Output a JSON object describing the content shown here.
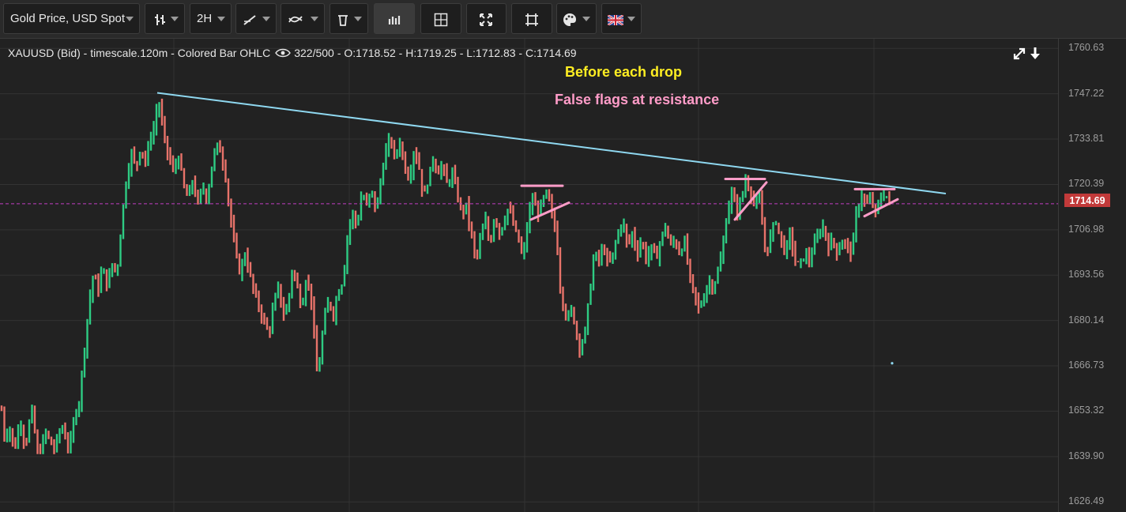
{
  "toolbar": {
    "symbol_select": "Gold Price, USD Spot",
    "timeframe": "2H",
    "icons": [
      "chart-style-icon",
      "timeframe-icon",
      "drawing-line-icon",
      "indicators-icon",
      "delete-drawing-icon",
      "volume-bars-icon",
      "crosshair-icon",
      "fullscreen-icon",
      "fit-screen-icon",
      "palette-icon",
      "language-flag-icon"
    ]
  },
  "header": {
    "instrument": "XAUUSD (Bid) - timescale.120m - Colored Bar OHLC",
    "bar_count": "322/500",
    "ohlc": "- O:1718.52 - H:1719.25 - L:1712.83 - C:1714.69"
  },
  "annotations": {
    "line1": "Before each drop",
    "line2": "False flags at resistance"
  },
  "colors": {
    "up": "#2ecc83",
    "down": "#e8736a",
    "trendline": "#8fd8f0",
    "flag": "#ff9cc8",
    "current_price_line": "#c13cc4",
    "price_tag": "#c23a3a",
    "annotation_yellow": "#ffee22",
    "grid": "#333333"
  },
  "chart_data": {
    "type": "ohlc",
    "symbol": "XAUUSD",
    "yaxis": {
      "ylim": [
        1623.5,
        1763.5
      ],
      "ticks": [
        "1760.63",
        "1747.22",
        "1733.81",
        "1720.39",
        "1714.69",
        "1706.98",
        "1693.56",
        "1680.14",
        "1666.73",
        "1653.32",
        "1639.90",
        "1626.49"
      ],
      "tick_values": [
        1760.63,
        1747.22,
        1733.81,
        1720.39,
        1706.98,
        1693.56,
        1680.14,
        1666.73,
        1653.32,
        1639.9,
        1626.49
      ]
    },
    "current_price": 1714.69,
    "grid": true,
    "path": [
      [
        0,
        1658
      ],
      [
        6,
        1645
      ],
      [
        12,
        1649
      ],
      [
        18,
        1641
      ],
      [
        25,
        1651
      ],
      [
        32,
        1643
      ],
      [
        40,
        1654
      ],
      [
        48,
        1640
      ],
      [
        58,
        1647
      ],
      [
        68,
        1642
      ],
      [
        78,
        1649
      ],
      [
        88,
        1642
      ],
      [
        96,
        1654
      ],
      [
        100,
        1656
      ],
      [
        106,
        1670
      ],
      [
        112,
        1684
      ],
      [
        118,
        1694
      ],
      [
        124,
        1689
      ],
      [
        130,
        1696
      ],
      [
        136,
        1690
      ],
      [
        142,
        1697
      ],
      [
        148,
        1694
      ],
      [
        154,
        1710
      ],
      [
        160,
        1722
      ],
      [
        166,
        1730
      ],
      [
        172,
        1725
      ],
      [
        178,
        1732
      ],
      [
        184,
        1727
      ],
      [
        190,
        1734
      ],
      [
        196,
        1738
      ],
      [
        200,
        1746
      ],
      [
        204,
        1740
      ],
      [
        208,
        1734
      ],
      [
        214,
        1728
      ],
      [
        220,
        1724
      ],
      [
        226,
        1729
      ],
      [
        232,
        1720
      ],
      [
        238,
        1716
      ],
      [
        244,
        1722
      ],
      [
        250,
        1714
      ],
      [
        256,
        1720
      ],
      [
        262,
        1716
      ],
      [
        268,
        1726
      ],
      [
        274,
        1732
      ],
      [
        280,
        1730
      ],
      [
        286,
        1722
      ],
      [
        292,
        1710
      ],
      [
        298,
        1700
      ],
      [
        304,
        1694
      ],
      [
        310,
        1700
      ],
      [
        316,
        1694
      ],
      [
        322,
        1688
      ],
      [
        328,
        1684
      ],
      [
        334,
        1680
      ],
      [
        340,
        1676
      ],
      [
        346,
        1684
      ],
      [
        352,
        1690
      ],
      [
        358,
        1682
      ],
      [
        364,
        1684
      ],
      [
        370,
        1696
      ],
      [
        376,
        1690
      ],
      [
        382,
        1684
      ],
      [
        388,
        1694
      ],
      [
        394,
        1686
      ],
      [
        398,
        1674
      ],
      [
        402,
        1662
      ],
      [
        406,
        1672
      ],
      [
        410,
        1680
      ],
      [
        416,
        1686
      ],
      [
        422,
        1682
      ],
      [
        428,
        1689
      ],
      [
        434,
        1692
      ],
      [
        440,
        1706
      ],
      [
        446,
        1712
      ],
      [
        452,
        1708
      ],
      [
        458,
        1718
      ],
      [
        464,
        1714
      ],
      [
        470,
        1719
      ],
      [
        476,
        1712
      ],
      [
        482,
        1722
      ],
      [
        488,
        1730
      ],
      [
        494,
        1734
      ],
      [
        500,
        1728
      ],
      [
        506,
        1733
      ],
      [
        512,
        1726
      ],
      [
        518,
        1722
      ],
      [
        524,
        1731
      ],
      [
        530,
        1726
      ],
      [
        536,
        1716
      ],
      [
        542,
        1722
      ],
      [
        548,
        1728
      ],
      [
        554,
        1724
      ],
      [
        560,
        1726
      ],
      [
        566,
        1720
      ],
      [
        572,
        1724
      ],
      [
        578,
        1718
      ],
      [
        584,
        1712
      ],
      [
        590,
        1714
      ],
      [
        596,
        1706
      ],
      [
        602,
        1698
      ],
      [
        608,
        1704
      ],
      [
        614,
        1710
      ],
      [
        620,
        1702
      ],
      [
        626,
        1712
      ],
      [
        632,
        1706
      ],
      [
        638,
        1710
      ],
      [
        644,
        1714
      ],
      [
        650,
        1708
      ],
      [
        656,
        1704
      ],
      [
        662,
        1698
      ],
      [
        668,
        1710
      ],
      [
        674,
        1716
      ],
      [
        680,
        1712
      ],
      [
        686,
        1715
      ],
      [
        692,
        1718
      ],
      [
        698,
        1712
      ],
      [
        704,
        1706
      ],
      [
        708,
        1692
      ],
      [
        712,
        1686
      ],
      [
        718,
        1680
      ],
      [
        724,
        1684
      ],
      [
        728,
        1678
      ],
      [
        734,
        1672
      ],
      [
        740,
        1676
      ],
      [
        746,
        1688
      ],
      [
        752,
        1700
      ],
      [
        758,
        1698
      ],
      [
        764,
        1702
      ],
      [
        770,
        1696
      ],
      [
        776,
        1700
      ],
      [
        782,
        1706
      ],
      [
        788,
        1710
      ],
      [
        794,
        1702
      ],
      [
        800,
        1706
      ],
      [
        806,
        1700
      ],
      [
        812,
        1704
      ],
      [
        818,
        1698
      ],
      [
        824,
        1702
      ],
      [
        830,
        1698
      ],
      [
        836,
        1704
      ],
      [
        842,
        1708
      ],
      [
        848,
        1702
      ],
      [
        854,
        1704
      ],
      [
        860,
        1700
      ],
      [
        866,
        1704
      ],
      [
        872,
        1694
      ],
      [
        878,
        1688
      ],
      [
        884,
        1684
      ],
      [
        890,
        1686
      ],
      [
        896,
        1692
      ],
      [
        902,
        1690
      ],
      [
        908,
        1694
      ],
      [
        914,
        1700
      ],
      [
        920,
        1712
      ],
      [
        926,
        1718
      ],
      [
        932,
        1712
      ],
      [
        938,
        1716
      ],
      [
        944,
        1722
      ],
      [
        950,
        1718
      ],
      [
        956,
        1714
      ],
      [
        962,
        1716
      ],
      [
        966,
        1704
      ],
      [
        970,
        1700
      ],
      [
        976,
        1706
      ],
      [
        982,
        1710
      ],
      [
        988,
        1704
      ],
      [
        994,
        1700
      ],
      [
        1000,
        1706
      ],
      [
        1006,
        1698
      ],
      [
        1012,
        1696
      ],
      [
        1018,
        1700
      ],
      [
        1024,
        1698
      ],
      [
        1030,
        1702
      ],
      [
        1036,
        1706
      ],
      [
        1042,
        1708
      ],
      [
        1048,
        1702
      ],
      [
        1054,
        1704
      ],
      [
        1060,
        1700
      ],
      [
        1066,
        1704
      ],
      [
        1072,
        1702
      ],
      [
        1078,
        1700
      ],
      [
        1084,
        1712
      ],
      [
        1090,
        1718
      ],
      [
        1096,
        1714
      ],
      [
        1102,
        1716
      ],
      [
        1108,
        1712
      ],
      [
        1114,
        1716
      ],
      [
        1120,
        1718
      ],
      [
        1128,
        1714
      ]
    ],
    "trendline": {
      "from": [
        199,
        1747.5
      ],
      "to": [
        1197,
        1717.7
      ]
    },
    "flags": [
      {
        "from": [
          660,
          1720
        ],
        "to": [
          712,
          1720
        ]
      },
      {
        "from": [
          672,
          1710
        ],
        "to": [
          720,
          1715
        ]
      },
      {
        "from": [
          918,
          1722
        ],
        "to": [
          968,
          1722
        ]
      },
      {
        "from": [
          930,
          1710
        ],
        "to": [
          970,
          1721
        ]
      },
      {
        "from": [
          1082,
          1719
        ],
        "to": [
          1132,
          1719
        ]
      },
      {
        "from": [
          1094,
          1711
        ],
        "to": [
          1136,
          1716
        ]
      }
    ]
  }
}
